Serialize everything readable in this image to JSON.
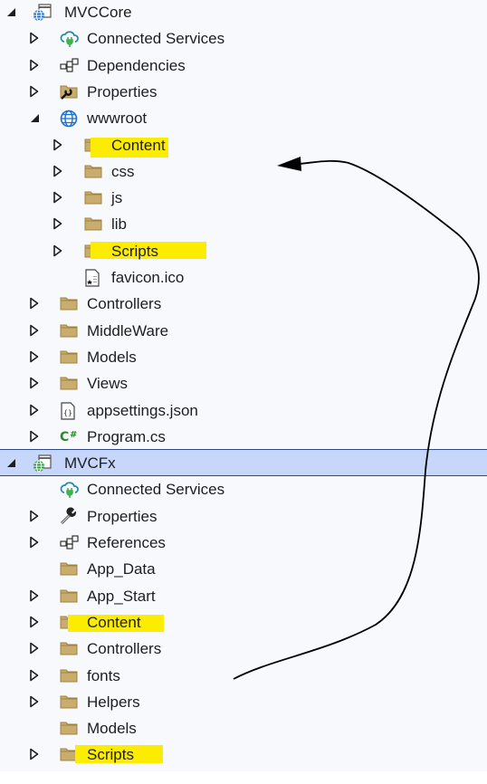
{
  "tree": [
    {
      "label": "MVCCore",
      "level": 0,
      "expander": "expanded",
      "icon": "web-project-icon",
      "selected": false,
      "highlight": false
    },
    {
      "label": "Connected Services",
      "level": 1,
      "expander": "collapsed",
      "icon": "connected-services-icon",
      "selected": false,
      "highlight": false
    },
    {
      "label": "Dependencies",
      "level": 1,
      "expander": "collapsed",
      "icon": "dependencies-icon",
      "selected": false,
      "highlight": false
    },
    {
      "label": "Properties",
      "level": 1,
      "expander": "collapsed",
      "icon": "properties-folder-icon",
      "selected": false,
      "highlight": false
    },
    {
      "label": "wwwroot",
      "level": 1,
      "expander": "expanded",
      "icon": "globe-icon",
      "selected": false,
      "highlight": false
    },
    {
      "label": "Content",
      "level": 2,
      "expander": "collapsed",
      "icon": "folder-icon",
      "selected": false,
      "highlight": true
    },
    {
      "label": "css",
      "level": 2,
      "expander": "collapsed",
      "icon": "folder-icon",
      "selected": false,
      "highlight": false
    },
    {
      "label": "js",
      "level": 2,
      "expander": "collapsed",
      "icon": "folder-icon",
      "selected": false,
      "highlight": false
    },
    {
      "label": "lib",
      "level": 2,
      "expander": "collapsed",
      "icon": "folder-icon",
      "selected": false,
      "highlight": false
    },
    {
      "label": "Scripts",
      "level": 2,
      "expander": "collapsed",
      "icon": "folder-icon",
      "selected": false,
      "highlight": true
    },
    {
      "label": "favicon.ico",
      "level": 2,
      "expander": "none",
      "icon": "favicon-file-icon",
      "selected": false,
      "highlight": false
    },
    {
      "label": "Controllers",
      "level": 1,
      "expander": "collapsed",
      "icon": "folder-icon",
      "selected": false,
      "highlight": false
    },
    {
      "label": "MiddleWare",
      "level": 1,
      "expander": "collapsed",
      "icon": "folder-icon",
      "selected": false,
      "highlight": false
    },
    {
      "label": "Models",
      "level": 1,
      "expander": "collapsed",
      "icon": "folder-icon",
      "selected": false,
      "highlight": false
    },
    {
      "label": "Views",
      "level": 1,
      "expander": "collapsed",
      "icon": "folder-icon",
      "selected": false,
      "highlight": false
    },
    {
      "label": "appsettings.json",
      "level": 1,
      "expander": "collapsed",
      "icon": "json-file-icon",
      "selected": false,
      "highlight": false
    },
    {
      "label": "Program.cs",
      "level": 1,
      "expander": "collapsed",
      "icon": "csharp-file-icon",
      "selected": false,
      "highlight": false
    },
    {
      "label": "MVCFx",
      "level": 0,
      "expander": "expanded",
      "icon": "web-project-icon",
      "selected": true,
      "highlight": false
    },
    {
      "label": "Connected Services",
      "level": 1,
      "expander": "none",
      "icon": "connected-services-icon",
      "selected": false,
      "highlight": false
    },
    {
      "label": "Properties",
      "level": 1,
      "expander": "collapsed",
      "icon": "wrench-icon",
      "selected": false,
      "highlight": false
    },
    {
      "label": "References",
      "level": 1,
      "expander": "collapsed",
      "icon": "dependencies-icon",
      "selected": false,
      "highlight": false
    },
    {
      "label": "App_Data",
      "level": 1,
      "expander": "none",
      "icon": "folder-icon",
      "selected": false,
      "highlight": false
    },
    {
      "label": "App_Start",
      "level": 1,
      "expander": "collapsed",
      "icon": "folder-icon",
      "selected": false,
      "highlight": false
    },
    {
      "label": "Content",
      "level": 1,
      "expander": "collapsed",
      "icon": "folder-icon",
      "selected": false,
      "highlight": true
    },
    {
      "label": "Controllers",
      "level": 1,
      "expander": "collapsed",
      "icon": "folder-icon",
      "selected": false,
      "highlight": false
    },
    {
      "label": "fonts",
      "level": 1,
      "expander": "collapsed",
      "icon": "folder-icon",
      "selected": false,
      "highlight": false
    },
    {
      "label": "Helpers",
      "level": 1,
      "expander": "collapsed",
      "icon": "folder-icon",
      "selected": false,
      "highlight": false
    },
    {
      "label": "Models",
      "level": 1,
      "expander": "none",
      "icon": "folder-icon",
      "selected": false,
      "highlight": false
    },
    {
      "label": "Scripts",
      "level": 1,
      "expander": "collapsed",
      "icon": "folder-icon",
      "selected": false,
      "highlight": true
    }
  ],
  "colors": {
    "highlight": "#fbec00",
    "selection_bg": "#c6d7fb",
    "selection_border": "#2c4a85",
    "folder": "#c9ad6e",
    "folder_stroke": "#a0823f",
    "globe": "#1d6fcf",
    "globe_green": "#2a9a3a",
    "csharp": "#2a8a2a",
    "cloud": "#1c8aa8",
    "plug": "#3bb54a"
  },
  "annotation": {
    "type": "curved-arrow",
    "from": "MVCFx/Content + Scripts",
    "to": "MVCCore/wwwroot/Content + Scripts"
  }
}
